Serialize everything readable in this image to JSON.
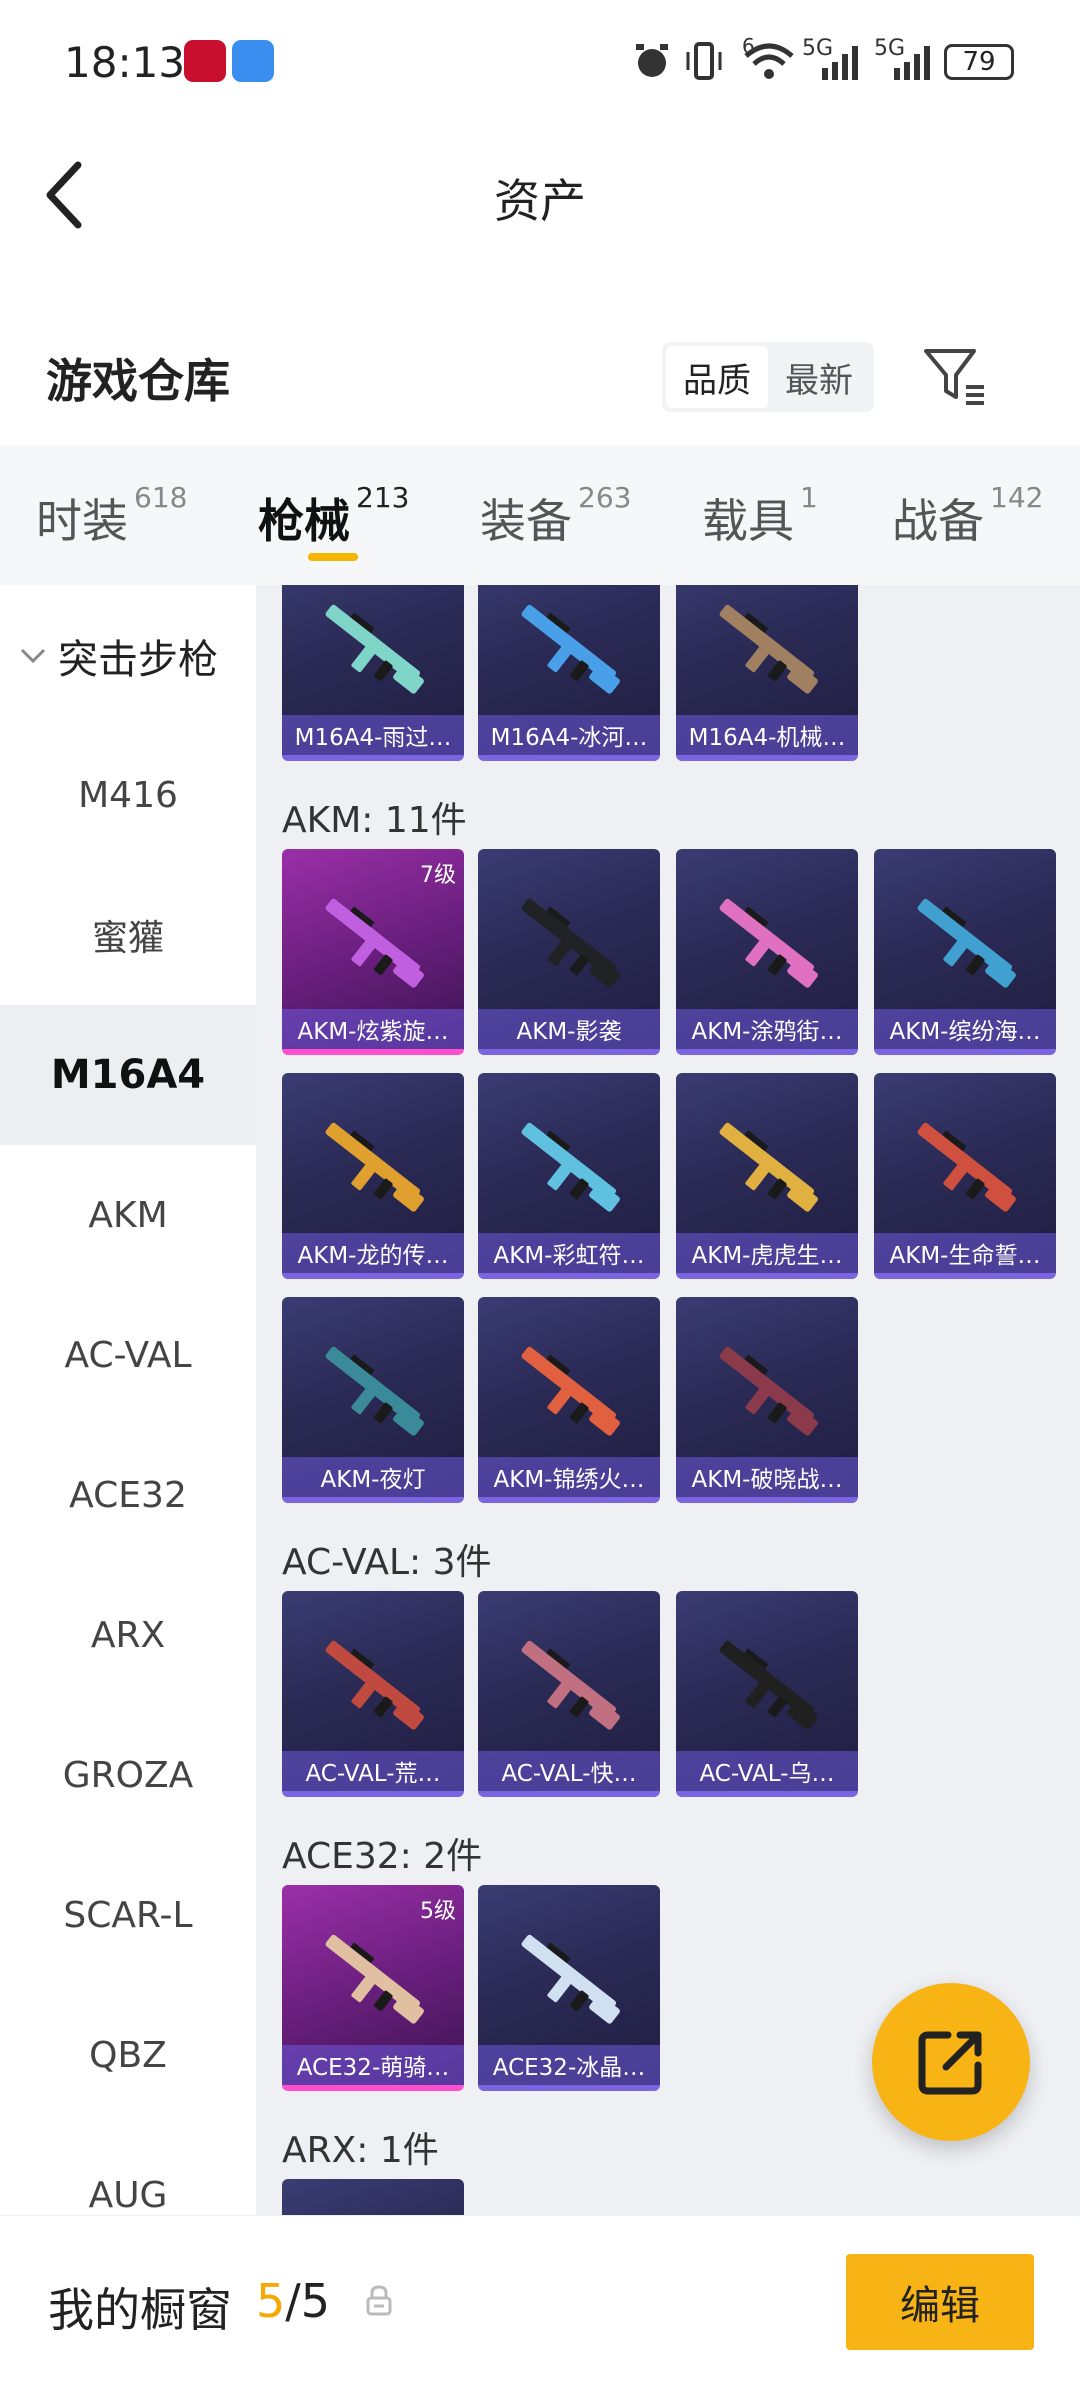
{
  "status_bar": {
    "time": "18:13",
    "battery": "79",
    "net_label_1": "5G",
    "net_label_2": "5G",
    "wifi_label": "6"
  },
  "header": {
    "title": "资产"
  },
  "warehouse": {
    "title": "游戏仓库",
    "sort_options": [
      "品质",
      "最新"
    ],
    "sort_selected": "品质"
  },
  "tabs": [
    {
      "label": "时装",
      "count": "618"
    },
    {
      "label": "枪械",
      "count": "213"
    },
    {
      "label": "装备",
      "count": "263"
    },
    {
      "label": "载具",
      "count": "1"
    },
    {
      "label": "战备",
      "count": "142"
    }
  ],
  "active_tab": "枪械",
  "sidebar": {
    "category": "突击步枪",
    "items": [
      "M416",
      "蜜獾",
      "M16A4",
      "AKM",
      "AC-VAL",
      "ACE32",
      "ARX",
      "GROZA",
      "SCAR-L",
      "QBZ",
      "AUG"
    ],
    "selected": "M16A4"
  },
  "sections": [
    {
      "label": "",
      "items": [
        {
          "name": "M16A4-雨过…",
          "rarity": "purple",
          "level": ""
        },
        {
          "name": "M16A4-冰河…",
          "rarity": "purple",
          "level": ""
        },
        {
          "name": "M16A4-机械…",
          "rarity": "purple",
          "level": ""
        }
      ]
    },
    {
      "label": "AKM: 11件",
      "items": [
        {
          "name": "AKM-炫紫旋…",
          "rarity": "pink",
          "level": "7级"
        },
        {
          "name": "AKM-影袭",
          "rarity": "purple",
          "level": ""
        },
        {
          "name": "AKM-涂鸦街…",
          "rarity": "purple",
          "level": ""
        },
        {
          "name": "AKM-缤纷海…",
          "rarity": "purple",
          "level": ""
        },
        {
          "name": "AKM-龙的传…",
          "rarity": "purple",
          "level": ""
        },
        {
          "name": "AKM-彩虹符…",
          "rarity": "purple",
          "level": ""
        },
        {
          "name": "AKM-虎虎生…",
          "rarity": "purple",
          "level": ""
        },
        {
          "name": "AKM-生命誓…",
          "rarity": "purple",
          "level": ""
        },
        {
          "name": "AKM-夜灯",
          "rarity": "purple",
          "level": ""
        },
        {
          "name": "AKM-锦绣火…",
          "rarity": "purple",
          "level": ""
        },
        {
          "name": "AKM-破晓战…",
          "rarity": "purple",
          "level": ""
        }
      ]
    },
    {
      "label": "AC-VAL: 3件",
      "items": [
        {
          "name": "AC-VAL-荒…",
          "rarity": "purple",
          "level": ""
        },
        {
          "name": "AC-VAL-快…",
          "rarity": "purple",
          "level": ""
        },
        {
          "name": "AC-VAL-乌…",
          "rarity": "purple",
          "level": ""
        }
      ]
    },
    {
      "label": "ACE32: 2件",
      "items": [
        {
          "name": "ACE32-萌骑…",
          "rarity": "pink",
          "level": "5级"
        },
        {
          "name": "ACE32-冰晶…",
          "rarity": "purple",
          "level": ""
        }
      ]
    },
    {
      "label": "ARX: 1件",
      "items": [
        {
          "name": "",
          "rarity": "purple",
          "level": ""
        }
      ]
    }
  ],
  "gun_colors": [
    "#7fd6c8",
    "#4aa0e8",
    "#a08060",
    "#c060e0",
    "#202226",
    "#e070c0",
    "#40a0d0",
    "#e0a030",
    "#60c0e0",
    "#e0b040",
    "#d05040",
    "#3a8a9a",
    "#e06040",
    "#8a3a4a",
    "#c04a40",
    "#c07080",
    "#202020",
    "#e0c0a0",
    "#d0e0f0"
  ],
  "bottom_bar": {
    "label": "我的橱窗",
    "current": "5",
    "total": "/5",
    "edit_label": "编辑"
  },
  "colors": {
    "accent": "#f8b414",
    "card_purple": "#2a2a55",
    "card_pink": "#7a247f"
  }
}
